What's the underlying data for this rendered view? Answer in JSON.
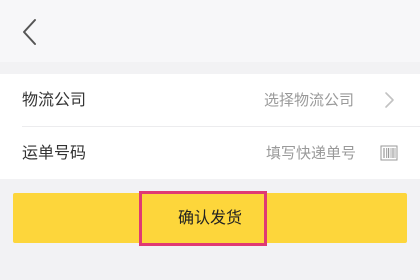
{
  "header": {
    "back_icon": "chevron-left-icon"
  },
  "form": {
    "logistics_company": {
      "label": "物流公司",
      "placeholder": "选择物流公司",
      "icon": "chevron-right-icon"
    },
    "tracking_number": {
      "label": "运单号码",
      "placeholder": "填写快递单号",
      "icon": "barcode-scan-icon"
    }
  },
  "actions": {
    "confirm_label": "确认发货"
  },
  "colors": {
    "button_bg": "#fdd63b",
    "highlight": "#e03a73",
    "background": "#f2f2f4"
  }
}
